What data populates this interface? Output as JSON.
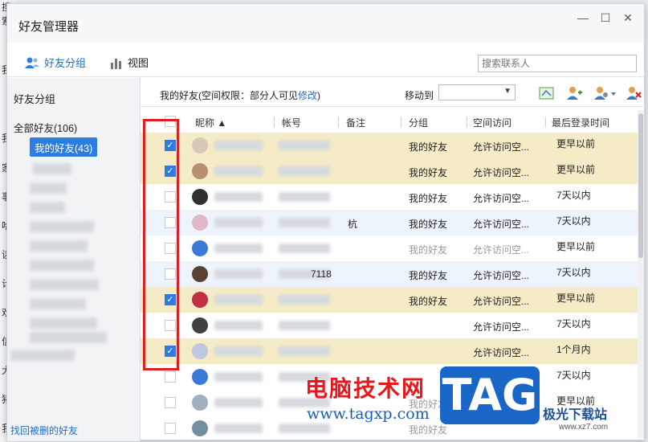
{
  "background": {
    "fragments": [
      "搜索",
      "我",
      "我",
      "家",
      "事",
      "哈",
      "读",
      "计",
      "欢",
      "信",
      "大",
      "猪",
      "我"
    ]
  },
  "window": {
    "title": "好友管理器",
    "controls": {
      "minimize": "—",
      "maximize": "☐",
      "close": "✕"
    }
  },
  "toolbar": {
    "tab_groups": "好友分组",
    "tab_view": "视图",
    "search_placeholder": "搜索联系人"
  },
  "sidebar": {
    "title": "好友分组",
    "all_friends": "全部好友(106)",
    "selected_group": "我的好友(43)",
    "footer_link": "找回被删的好友"
  },
  "main": {
    "header_prefix": "我的好友(空间权限：部分人可见",
    "header_link": "修改",
    "header_suffix": ")",
    "move_to": "移动到",
    "columns": [
      "昵称",
      "帐号",
      "备注",
      "分组",
      "空间访问",
      "最后登录时间"
    ],
    "rows": [
      {
        "checked": true,
        "state": "sel",
        "group": "我的好友",
        "access": "允许访问空...",
        "last_login": "更早以前",
        "avatar_color": "#d8c8b8"
      },
      {
        "checked": true,
        "state": "sel",
        "group": "我的好友",
        "access": "允许访问空...",
        "last_login": "更早以前",
        "avatar_color": "#b89070"
      },
      {
        "checked": false,
        "state": "",
        "group": "我的好友",
        "access": "允许访问空...",
        "last_login": "7天以内",
        "avatar_color": "#303030"
      },
      {
        "checked": false,
        "state": "alt",
        "group": "我的好友",
        "access": "允许访问空...",
        "last_login": "7天以内",
        "avatar_color": "#e0b8c8",
        "nick_tail": "杭"
      },
      {
        "checked": false,
        "state": "",
        "group": "我的好友",
        "access": "允许访问空...",
        "last_login": "更早以前",
        "avatar_color": "#3a7bd5",
        "faint": true
      },
      {
        "checked": false,
        "state": "alt",
        "group": "我的好友",
        "access": "允许访问空...",
        "last_login": "7天以内",
        "avatar_color": "#5a4030",
        "account_tail": "7118"
      },
      {
        "checked": true,
        "state": "sel",
        "group": "我的好友",
        "access": "允许访问空...",
        "last_login": "更早以前",
        "avatar_color": "#c03040"
      },
      {
        "checked": false,
        "state": "",
        "group": "",
        "access": "允许访问空...",
        "last_login": "7天以内",
        "avatar_color": "#404040"
      },
      {
        "checked": true,
        "state": "sel",
        "group": "",
        "access": "允许访问空...",
        "last_login": "1个月内",
        "avatar_color": "#c0c8e0"
      },
      {
        "checked": false,
        "state": "",
        "group": "",
        "access": "",
        "last_login": "7天以内",
        "avatar_color": "#3a7bd5"
      },
      {
        "checked": false,
        "state": "",
        "group": "我的好友",
        "access": "",
        "last_login": "更早以前",
        "avatar_color": "#a0b0c0",
        "faint": true
      },
      {
        "checked": false,
        "state": "",
        "group": "我的好友",
        "access": "",
        "last_login": "",
        "avatar_color": "#7090a0",
        "faint": true
      }
    ]
  },
  "watermark": {
    "cn_title": "电脑技术网",
    "url": "www.tagxp.com",
    "tag": "TAG",
    "site": "极光下载站",
    "site_url": "www.xz7.com"
  },
  "colors": {
    "accent": "#2b7de1",
    "selected_row": "#f5ebc6",
    "highlight_box": "#e02020"
  }
}
